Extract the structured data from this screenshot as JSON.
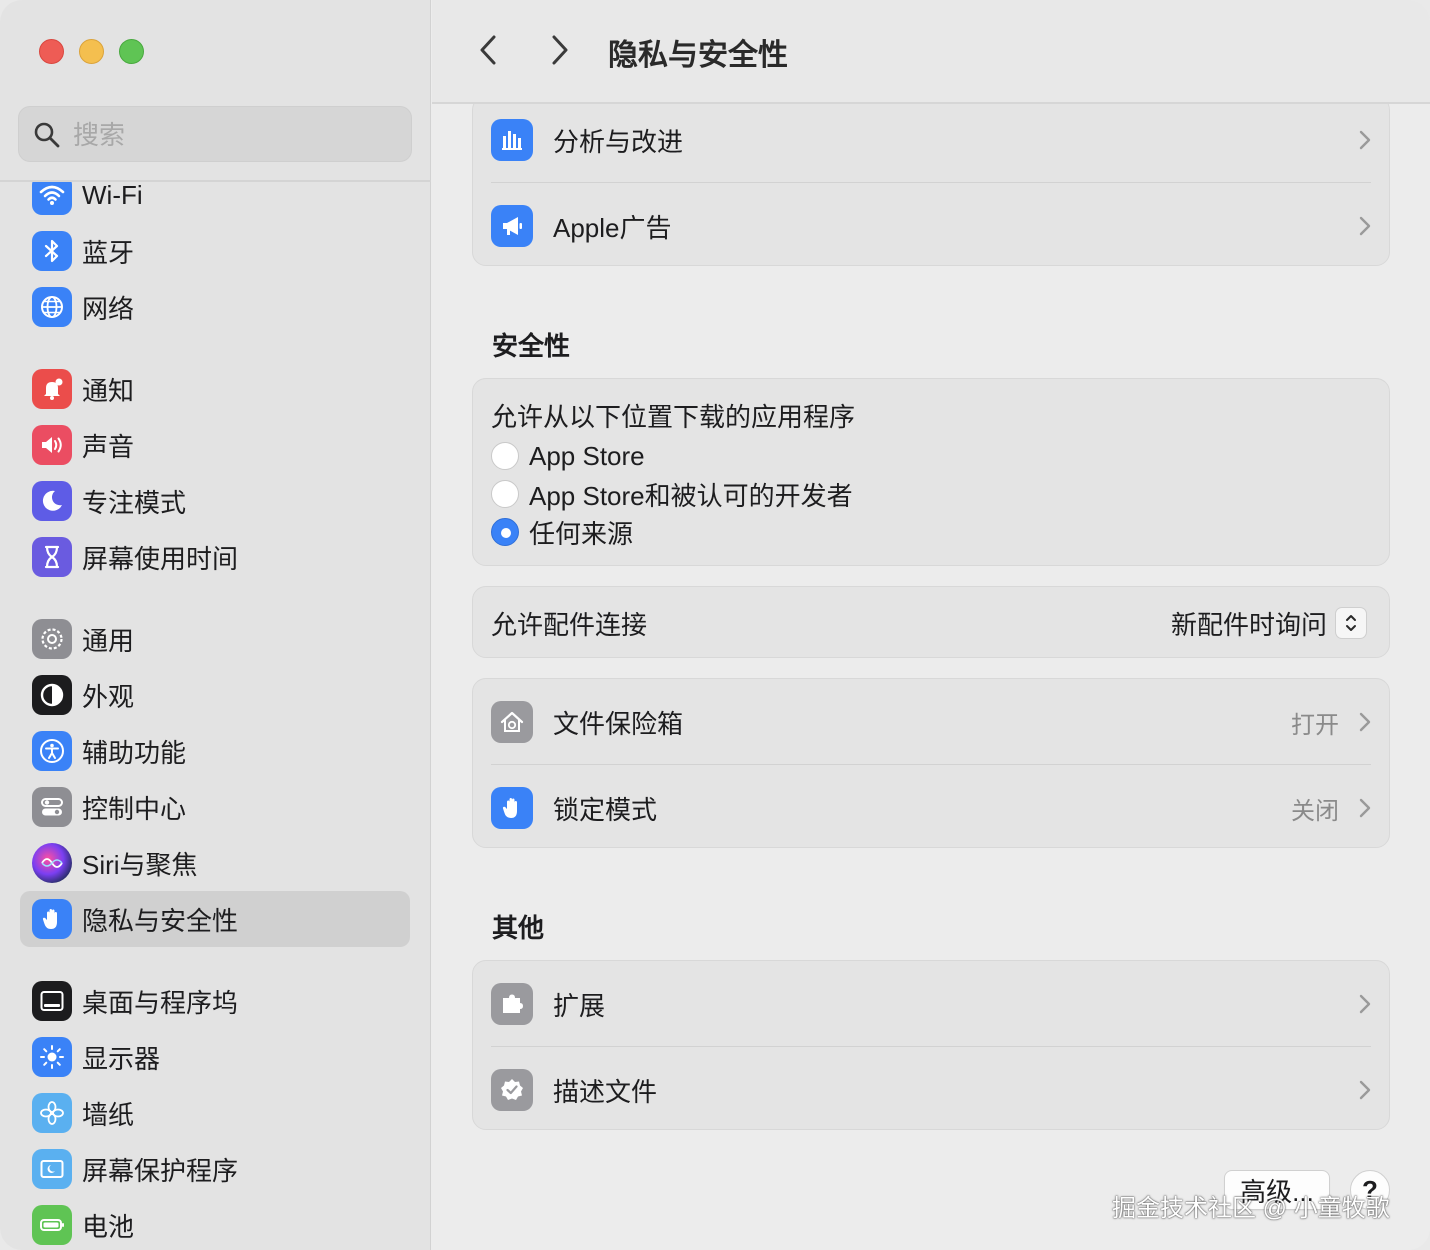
{
  "window": {
    "colors": {
      "red": "#ee5c55",
      "yellow": "#f4bf4f",
      "green": "#5fc454",
      "accent": "#3a82f7"
    }
  },
  "search": {
    "placeholder": "搜索",
    "value": ""
  },
  "sidebar": {
    "items": [
      {
        "label": "Wi-Fi",
        "icon": "wifi-icon",
        "color": "#3a82f7"
      },
      {
        "label": "蓝牙",
        "icon": "bluetooth-icon",
        "color": "#3a82f7"
      },
      {
        "label": "网络",
        "icon": "globe-icon",
        "color": "#3a82f7"
      },
      {
        "label": "通知",
        "icon": "bell-icon",
        "color": "#eb4d4b"
      },
      {
        "label": "声音",
        "icon": "speaker-icon",
        "color": "#eb4d62"
      },
      {
        "label": "专注模式",
        "icon": "moon-icon",
        "color": "#5e5ce6"
      },
      {
        "label": "屏幕使用时间",
        "icon": "hourglass-icon",
        "color": "#6a5be0"
      },
      {
        "label": "通用",
        "icon": "gear-icon",
        "color": "#8e8e93"
      },
      {
        "label": "外观",
        "icon": "appearance-icon",
        "color": "#1c1c1e"
      },
      {
        "label": "辅助功能",
        "icon": "accessibility-icon",
        "color": "#3a82f7"
      },
      {
        "label": "控制中心",
        "icon": "toggles-icon",
        "color": "#8e8e93"
      },
      {
        "label": "Siri与聚焦",
        "icon": "siri-icon",
        "color": "#2b2b3a"
      },
      {
        "label": "隐私与安全性",
        "icon": "hand-icon",
        "color": "#3a82f7",
        "selected": true
      },
      {
        "label": "桌面与程序坞",
        "icon": "dock-icon",
        "color": "#1c1c1e"
      },
      {
        "label": "显示器",
        "icon": "sun-icon",
        "color": "#3a82f7"
      },
      {
        "label": "墙纸",
        "icon": "flower-icon",
        "color": "#5ab0f0"
      },
      {
        "label": "屏幕保护程序",
        "icon": "screensaver-icon",
        "color": "#5ab0f0"
      },
      {
        "label": "电池",
        "icon": "battery-icon",
        "color": "#5fc454"
      }
    ]
  },
  "header": {
    "title": "隐私与安全性",
    "back": "chevron-left-icon",
    "forward": "chevron-right-icon"
  },
  "top_card": {
    "rows": [
      {
        "label": "分析与改进",
        "icon": "bar-chart-icon"
      },
      {
        "label": "Apple广告",
        "icon": "megaphone-icon"
      }
    ]
  },
  "security": {
    "title": "安全性",
    "downloads": {
      "heading": "允许从以下位置下载的应用程序",
      "options": [
        {
          "label": "App Store",
          "selected": false
        },
        {
          "label": "App Store和被认可的开发者",
          "selected": false
        },
        {
          "label": "任何来源",
          "selected": true
        }
      ]
    },
    "accessories": {
      "label": "允许配件连接",
      "value": "新配件时询问"
    },
    "rows": [
      {
        "label": "文件保险箱",
        "value": "打开",
        "icon": "house-safe-icon"
      },
      {
        "label": "锁定模式",
        "value": "关闭",
        "icon": "hand-icon"
      }
    ]
  },
  "other": {
    "title": "其他",
    "rows": [
      {
        "label": "扩展",
        "icon": "puzzle-icon"
      },
      {
        "label": "描述文件",
        "icon": "checkmark-seal-icon"
      }
    ]
  },
  "footer": {
    "advanced_label": "高级...",
    "help_label": "?"
  },
  "watermark": "掘金技术社区 @ 小童牧歌"
}
